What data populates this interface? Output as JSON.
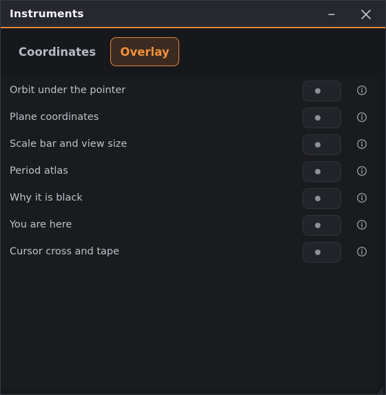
{
  "window": {
    "title": "Instruments",
    "minimize_icon": "minimize-icon",
    "close_icon": "close-icon"
  },
  "tabs": [
    {
      "label": "Coordinates",
      "active": false
    },
    {
      "label": "Overlay",
      "active": true
    }
  ],
  "overlay": {
    "rows": [
      {
        "label": "Orbit under the pointer",
        "enabled": false
      },
      {
        "label": "Plane coordinates",
        "enabled": false
      },
      {
        "label": "Scale bar and view size",
        "enabled": false
      },
      {
        "label": "Period atlas",
        "enabled": false
      },
      {
        "label": "Why it is black",
        "enabled": false
      },
      {
        "label": "You are here",
        "enabled": false
      },
      {
        "label": "Cursor cross and tape",
        "enabled": false
      }
    ]
  },
  "colors": {
    "accent": "#e8893c",
    "background": "#17181c",
    "titlebar": "#26272f"
  }
}
